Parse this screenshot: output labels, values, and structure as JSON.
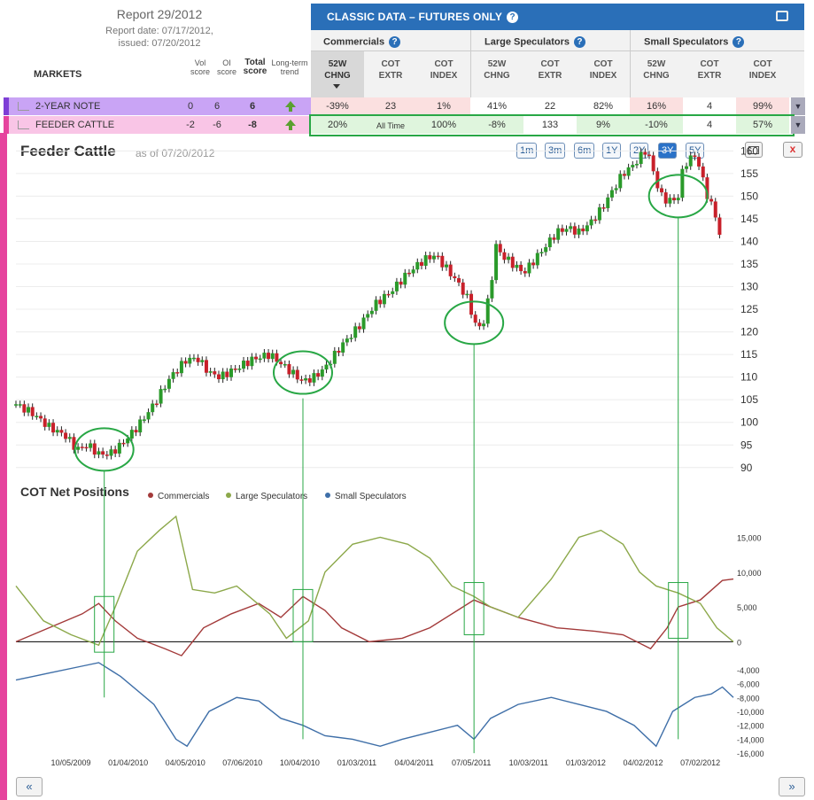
{
  "report": {
    "title": "Report 29/2012",
    "date_line": "Report date: 07/17/2012,",
    "issued_line": "issued: 07/20/2012"
  },
  "classic": {
    "title": "CLASSIC DATA – FUTURES ONLY"
  },
  "groups": {
    "commercials": "Commercials",
    "large": "Large Speculators",
    "small": "Small Speculators"
  },
  "columns": [
    {
      "l1": "52W",
      "l2": "CHNG"
    },
    {
      "l1": "COT",
      "l2": "EXTR"
    },
    {
      "l1": "COT",
      "l2": "INDEX"
    },
    {
      "l1": "52W",
      "l2": "CHNG"
    },
    {
      "l1": "COT",
      "l2": "EXTR"
    },
    {
      "l1": "COT",
      "l2": "INDEX"
    },
    {
      "l1": "52W",
      "l2": "CHNG"
    },
    {
      "l1": "COT",
      "l2": "EXTR"
    },
    {
      "l1": "COT",
      "l2": "INDEX"
    }
  ],
  "left_headers": {
    "markets": "MARKETS",
    "vol1": "Vol",
    "vol2": "score",
    "oi1": "OI",
    "oi2": "score",
    "tot1": "Total",
    "tot2": "score",
    "lt1": "Long-term",
    "lt2": "trend"
  },
  "rows": [
    {
      "market": "2-YEAR NOTE",
      "vol": "0",
      "oi": "6",
      "total": "6",
      "cells": [
        "-39%",
        "23",
        "1%",
        "41%",
        "22",
        "82%",
        "16%",
        "4",
        "99%"
      ]
    },
    {
      "market": "FEEDER CATTLE",
      "vol": "-2",
      "oi": "-6",
      "total": "-8",
      "cells": [
        "20%",
        "All Time",
        "100%",
        "-8%",
        "133",
        "9%",
        "-10%",
        "4",
        "57%"
      ]
    }
  ],
  "chart": {
    "title": "Feeder Cattle",
    "as_of": "as of 07/20/2012"
  },
  "ranges": [
    "1m",
    "3m",
    "6m",
    "1Y",
    "2Y",
    "3Y",
    "5Y"
  ],
  "active_range": "3Y",
  "close_label": "x",
  "cot": {
    "title": "COT Net Positions",
    "legend": [
      "Commercials",
      "Large Speculators",
      "Small Speculators"
    ]
  },
  "colors": {
    "commercials": "#a33a3a",
    "large": "#8ca84a",
    "small": "#3f6fa8",
    "up": "#2a9a2a",
    "down": "#c8202a",
    "highlight": "#28a745",
    "accent": "#2a6fb8"
  },
  "nav": {
    "prev": "«",
    "next": "»"
  },
  "chart_data": [
    {
      "type": "candlestick",
      "title": "Feeder Cattle",
      "ylim": [
        88,
        163
      ],
      "yticks": [
        90,
        95,
        100,
        105,
        110,
        115,
        120,
        125,
        130,
        135,
        140,
        145,
        150,
        155,
        160
      ],
      "x_labels": [
        "10/05/2009",
        "01/04/2010",
        "04/05/2010",
        "07/06/2010",
        "10/04/2010",
        "01/03/2011",
        "04/04/2011",
        "07/05/2011",
        "10/03/2011",
        "01/03/2012",
        "04/02/2012",
        "07/02/2012"
      ],
      "price_path": [
        [
          0,
          104
        ],
        [
          6,
          102
        ],
        [
          12,
          99
        ],
        [
          18,
          97
        ],
        [
          22,
          94
        ],
        [
          26,
          95
        ],
        [
          30,
          93
        ],
        [
          34,
          93
        ],
        [
          38,
          95
        ],
        [
          44,
          99
        ],
        [
          50,
          104
        ],
        [
          56,
          110
        ],
        [
          62,
          114
        ],
        [
          66,
          114
        ],
        [
          70,
          111
        ],
        [
          74,
          110
        ],
        [
          80,
          112
        ],
        [
          86,
          114
        ],
        [
          92,
          115
        ],
        [
          96,
          113
        ],
        [
          100,
          111
        ],
        [
          104,
          109
        ],
        [
          108,
          110
        ],
        [
          112,
          112
        ],
        [
          118,
          117
        ],
        [
          124,
          121
        ],
        [
          130,
          126
        ],
        [
          136,
          129
        ],
        [
          142,
          133
        ],
        [
          148,
          136
        ],
        [
          152,
          137
        ],
        [
          156,
          134
        ],
        [
          160,
          131
        ],
        [
          164,
          127
        ],
        [
          166,
          122
        ],
        [
          168,
          121
        ],
        [
          170,
          123
        ],
        [
          172,
          130
        ],
        [
          174,
          139
        ],
        [
          176,
          137
        ],
        [
          180,
          135
        ],
        [
          184,
          133
        ],
        [
          188,
          136
        ],
        [
          192,
          139
        ],
        [
          196,
          142
        ],
        [
          200,
          143
        ],
        [
          204,
          142
        ],
        [
          208,
          144
        ],
        [
          212,
          147
        ],
        [
          216,
          151
        ],
        [
          220,
          155
        ],
        [
          224,
          157
        ],
        [
          228,
          160
        ],
        [
          230,
          158
        ],
        [
          232,
          153
        ],
        [
          234,
          150
        ],
        [
          236,
          149
        ],
        [
          238,
          149
        ],
        [
          240,
          150
        ],
        [
          242,
          157
        ],
        [
          246,
          159
        ],
        [
          248,
          156
        ],
        [
          250,
          151
        ],
        [
          252,
          148
        ],
        [
          254,
          145
        ],
        [
          256,
          138
        ]
      ],
      "circles": [
        {
          "x": 32,
          "y": 94
        },
        {
          "x": 104,
          "y": 111
        },
        {
          "x": 166,
          "y": 122
        },
        {
          "x": 240,
          "y": 150
        }
      ]
    },
    {
      "type": "line",
      "title": "COT Net Positions",
      "ylim": [
        -17000,
        19000
      ],
      "yticks": [
        15000,
        10000,
        5000,
        0,
        -4000,
        -6000,
        -8000,
        -10000,
        -12000,
        -14000,
        -16000
      ],
      "series": [
        {
          "name": "Commercials",
          "points": [
            [
              0,
              0
            ],
            [
              12,
              2000
            ],
            [
              24,
              4000
            ],
            [
              30,
              5500
            ],
            [
              36,
              3000
            ],
            [
              44,
              500
            ],
            [
              54,
              -1000
            ],
            [
              60,
              -2000
            ],
            [
              68,
              2000
            ],
            [
              78,
              4000
            ],
            [
              88,
              5500
            ],
            [
              96,
              3500
            ],
            [
              104,
              6500
            ],
            [
              112,
              4500
            ],
            [
              118,
              2000
            ],
            [
              128,
              0
            ],
            [
              140,
              500
            ],
            [
              150,
              2000
            ],
            [
              160,
              4500
            ],
            [
              166,
              6000
            ],
            [
              172,
              5000
            ],
            [
              182,
              3500
            ],
            [
              196,
              2000
            ],
            [
              210,
              1500
            ],
            [
              220,
              1000
            ],
            [
              230,
              -1000
            ],
            [
              236,
              2000
            ],
            [
              240,
              5000
            ],
            [
              248,
              6000
            ],
            [
              256,
              8800
            ],
            [
              260,
              9000
            ]
          ]
        },
        {
          "name": "Large Speculators",
          "points": [
            [
              0,
              8000
            ],
            [
              10,
              3000
            ],
            [
              20,
              1000
            ],
            [
              30,
              -500
            ],
            [
              36,
              5000
            ],
            [
              44,
              13000
            ],
            [
              52,
              16000
            ],
            [
              58,
              18000
            ],
            [
              64,
              7500
            ],
            [
              72,
              7000
            ],
            [
              80,
              8000
            ],
            [
              86,
              6000
            ],
            [
              92,
              4000
            ],
            [
              98,
              500
            ],
            [
              106,
              3000
            ],
            [
              112,
              10000
            ],
            [
              122,
              14000
            ],
            [
              132,
              15000
            ],
            [
              142,
              14000
            ],
            [
              150,
              12000
            ],
            [
              158,
              8000
            ],
            [
              166,
              6500
            ],
            [
              172,
              5000
            ],
            [
              182,
              3500
            ],
            [
              194,
              9000
            ],
            [
              204,
              15000
            ],
            [
              212,
              16000
            ],
            [
              220,
              14000
            ],
            [
              226,
              10000
            ],
            [
              232,
              8000
            ],
            [
              240,
              7000
            ],
            [
              248,
              5500
            ],
            [
              254,
              2000
            ],
            [
              260,
              0
            ]
          ]
        },
        {
          "name": "Small Speculators",
          "points": [
            [
              0,
              -5500
            ],
            [
              12,
              -4500
            ],
            [
              24,
              -3500
            ],
            [
              30,
              -3000
            ],
            [
              38,
              -5000
            ],
            [
              50,
              -9000
            ],
            [
              58,
              -14000
            ],
            [
              62,
              -15000
            ],
            [
              70,
              -10000
            ],
            [
              80,
              -8000
            ],
            [
              88,
              -8500
            ],
            [
              96,
              -11000
            ],
            [
              104,
              -12000
            ],
            [
              112,
              -13500
            ],
            [
              122,
              -14000
            ],
            [
              132,
              -15000
            ],
            [
              140,
              -14000
            ],
            [
              150,
              -13000
            ],
            [
              160,
              -12000
            ],
            [
              166,
              -14000
            ],
            [
              172,
              -11000
            ],
            [
              182,
              -9000
            ],
            [
              194,
              -8000
            ],
            [
              204,
              -9000
            ],
            [
              214,
              -10000
            ],
            [
              224,
              -12000
            ],
            [
              232,
              -15000
            ],
            [
              238,
              -10000
            ],
            [
              246,
              -8000
            ],
            [
              252,
              -7500
            ],
            [
              256,
              -6500
            ],
            [
              260,
              -8000
            ]
          ]
        }
      ],
      "boxes": [
        {
          "x": 32,
          "y0": -1500,
          "y1": 6500
        },
        {
          "x": 104,
          "y0": 0,
          "y1": 7500
        },
        {
          "x": 166,
          "y0": 1000,
          "y1": 8500
        },
        {
          "x": 240,
          "y0": 500,
          "y1": 8500
        }
      ]
    }
  ]
}
